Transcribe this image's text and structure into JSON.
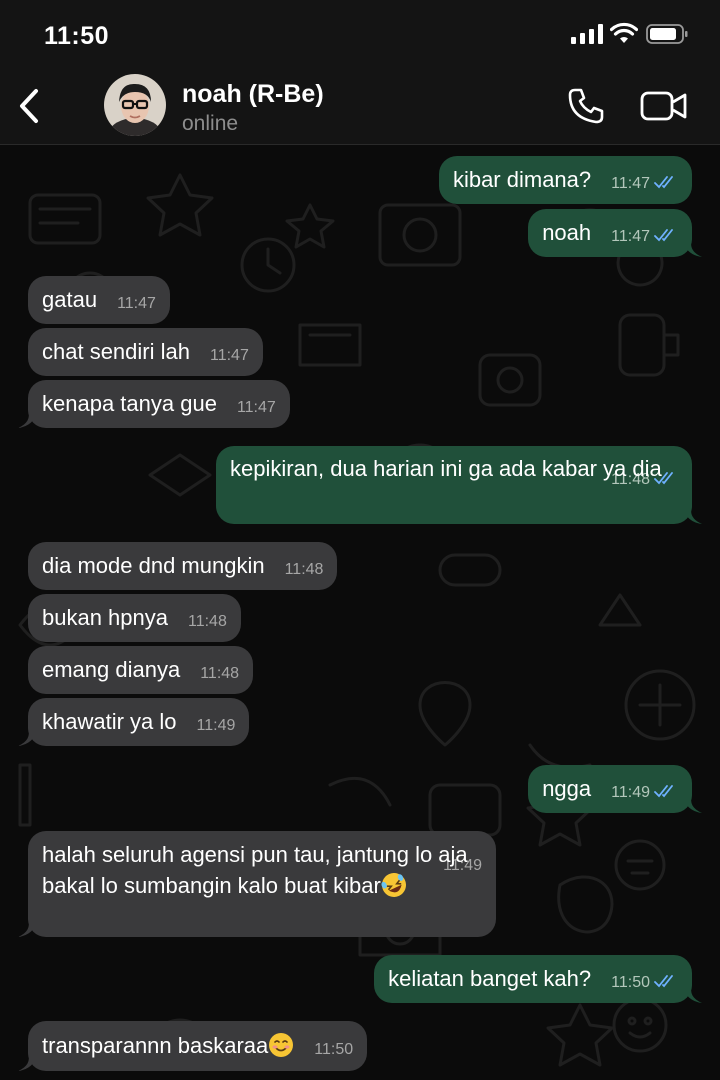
{
  "status_bar": {
    "time": "11:50"
  },
  "header": {
    "back_icon": "chevron-left-icon",
    "contact_name": "noah (R-Be)",
    "contact_status": "online",
    "call_icon": "phone-icon",
    "video_icon": "video-camera-icon"
  },
  "messages": [
    {
      "dir": "out",
      "text": "kibar dimana?",
      "time": "11:47",
      "read": true
    },
    {
      "dir": "out",
      "text": "noah",
      "time": "11:47",
      "read": true
    },
    {
      "dir": "in",
      "text": "gatau",
      "time": "11:47"
    },
    {
      "dir": "in",
      "text": "chat sendiri lah",
      "time": "11:47"
    },
    {
      "dir": "in",
      "text": "kenapa tanya gue",
      "time": "11:47"
    },
    {
      "dir": "out",
      "text": "kepikiran, dua harian ini ga ada kabar ya dia",
      "time": "11:48",
      "read": true
    },
    {
      "dir": "in",
      "text": "dia mode dnd mungkin",
      "time": "11:48"
    },
    {
      "dir": "in",
      "text": "bukan hpnya",
      "time": "11:48"
    },
    {
      "dir": "in",
      "text": "emang dianya",
      "time": "11:48"
    },
    {
      "dir": "in",
      "text": "khawatir ya lo",
      "time": "11:49"
    },
    {
      "dir": "out",
      "text": "ngga",
      "time": "11:49",
      "read": true
    },
    {
      "dir": "in",
      "text": "halah seluruh agensi pun tau, jantung lo aja bakal lo sumbangin kalo buat kibar",
      "emoji": "rolling-on-floor-laughing",
      "time": "11:49"
    },
    {
      "dir": "out",
      "text": "keliatan banget kah?",
      "time": "11:50",
      "read": true
    },
    {
      "dir": "in",
      "text": "transparannn baskaraa",
      "emoji": "smiling-face",
      "time": "11:50"
    }
  ]
}
